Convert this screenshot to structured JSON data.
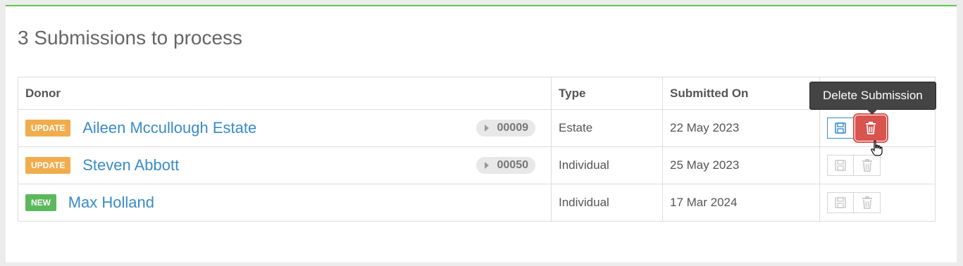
{
  "title": "3 Submissions to process",
  "table": {
    "headers": [
      "Donor",
      "Type",
      "Submitted On"
    ],
    "rows": [
      {
        "badge": "UPDATE",
        "badge_type": "update",
        "donor": "Aileen Mccullough Estate",
        "ref": "00009",
        "type": "Estate",
        "submitted_on": "22 May 2023"
      },
      {
        "badge": "UPDATE",
        "badge_type": "update",
        "donor": "Steven Abbott",
        "ref": "00050",
        "type": "Individual",
        "submitted_on": "25 May 2023"
      },
      {
        "badge": "NEW",
        "badge_type": "new",
        "donor": "Max Holland",
        "ref": "",
        "type": "Individual",
        "submitted_on": "17 Mar 2024"
      }
    ]
  },
  "tooltip": "Delete Submission",
  "icons": {
    "save": "floppy-disk-icon",
    "delete": "trash-icon",
    "expand": "play-triangle-icon",
    "cursor": "hand-pointer-icon"
  },
  "colors": {
    "accent_green": "#5cc84a",
    "link_blue": "#3a8bc8",
    "update_badge": "#f0ad4e",
    "new_badge": "#5cb85c",
    "danger": "#d9534f"
  }
}
